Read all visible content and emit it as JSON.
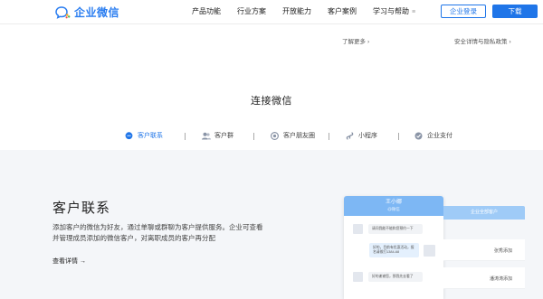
{
  "header": {
    "logo_text": "企业微信",
    "nav": [
      {
        "label": "产品功能"
      },
      {
        "label": "行业方案"
      },
      {
        "label": "开放能力"
      },
      {
        "label": "客户案例"
      },
      {
        "label": "学习与帮助",
        "caret": "≡"
      }
    ],
    "login_label": "企业登录",
    "download_label": "下载"
  },
  "sublinks": {
    "learn_more": "了解更多",
    "security": "安全详情与隐私政策",
    "arrow": "›"
  },
  "section_title": "连接微信",
  "tabs": [
    {
      "label": "客户联系",
      "icon": "chat-bubble-icon",
      "active": true
    },
    {
      "label": "客户群",
      "icon": "group-icon",
      "active": false
    },
    {
      "label": "客户朋友圈",
      "icon": "moments-icon",
      "active": false
    },
    {
      "label": "小程序",
      "icon": "mini-program-icon",
      "active": false
    },
    {
      "label": "企业支付",
      "icon": "pay-icon",
      "active": false
    }
  ],
  "content": {
    "title": "客户联系",
    "description_line1": "添加客户的微信为好友，通过单聊或群聊为客户提供服务。企业可查看",
    "description_line2": "并管理成员添加的微信客户，对离职成员的客户再分配",
    "more_label": "查看详情 →"
  },
  "phone": {
    "contact_name": "王小娜",
    "contact_status": "@微信",
    "messages": [
      {
        "side": "left",
        "text": "请问我能不能和您预约一下"
      },
      {
        "side": "right",
        "text": "好的，目前有优惠活动，报名请拨打1384-68"
      },
      {
        "side": "left",
        "text": "好的谢谢您，那我先去看了"
      }
    ]
  },
  "right_panel": {
    "header": "企业全部客户",
    "rows": [
      "张秀添加",
      "潘涛涛添加"
    ]
  },
  "colors": {
    "brand_blue": "#1f75e8",
    "content_bg": "#f4f6f9",
    "phone_header": "#7db7f4"
  }
}
